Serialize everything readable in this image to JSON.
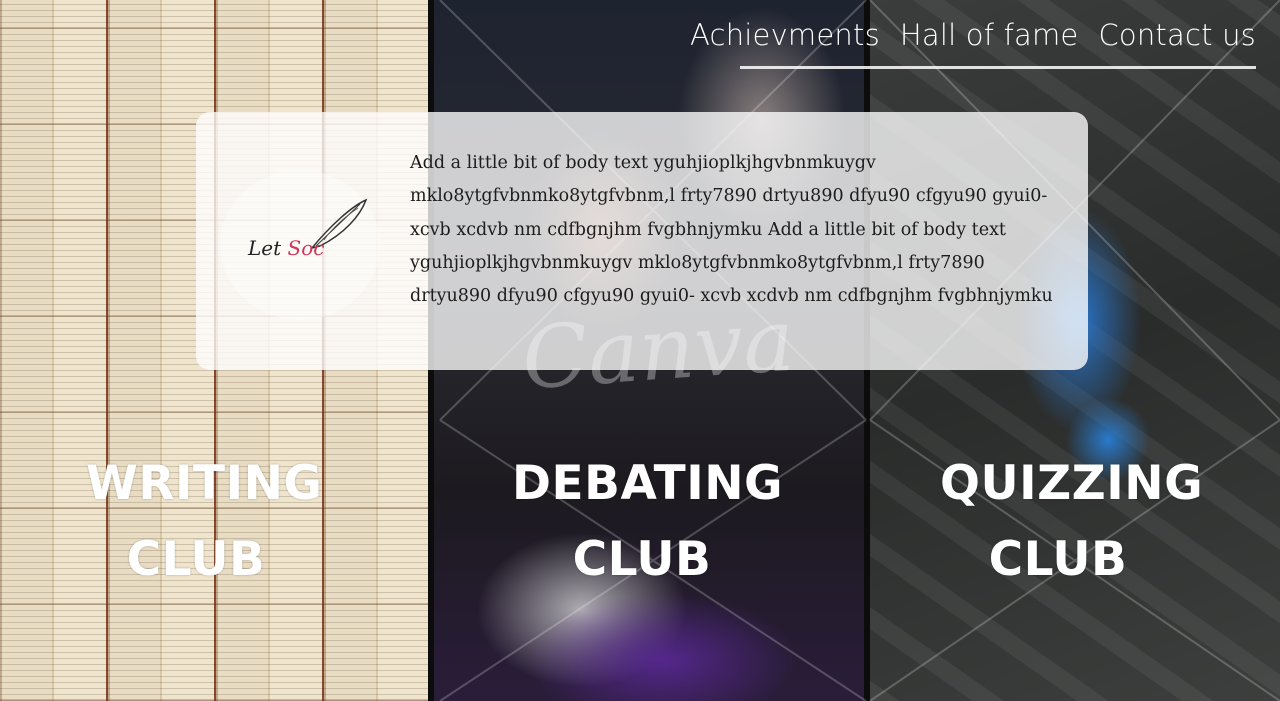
{
  "nav": {
    "items": [
      "Achievments",
      "Hall of fame",
      "Contact us"
    ]
  },
  "logo": {
    "text_main": "Let",
    "text_accent": "Soc"
  },
  "card": {
    "body": "Add a little bit of body text yguhjioplkjhgvbnmkuygv mklo8ytgfvbnmko8ytgfvbnm,l  frty7890 drtyu890 dfyu90 cfgyu90 gyui0- xcvb xcdvb nm cdfbgnjhm fvgbhnjymku Add a little bit of body text yguhjioplkjhgvbnmkuygv mklo8ytgfvbnmko8ytgfvbnm,l frty7890 drtyu890 dfyu90 cfgyu90 gyui0- xcvb xcdvb nm cdfbgnjhm fvgbhnjymku"
  },
  "clubs": {
    "writing": {
      "line1": "WRITING",
      "line2": "CLUB"
    },
    "debating": {
      "line1": "DEBATING",
      "line2": "CLUB"
    },
    "quizzing": {
      "line1": "QUIZZING",
      "line2": "CLUB"
    }
  },
  "watermark": {
    "text": "Canva"
  },
  "colors": {
    "accent": "#d2345a",
    "card_bg": "#ffffff",
    "text": "#1c1c1c"
  }
}
